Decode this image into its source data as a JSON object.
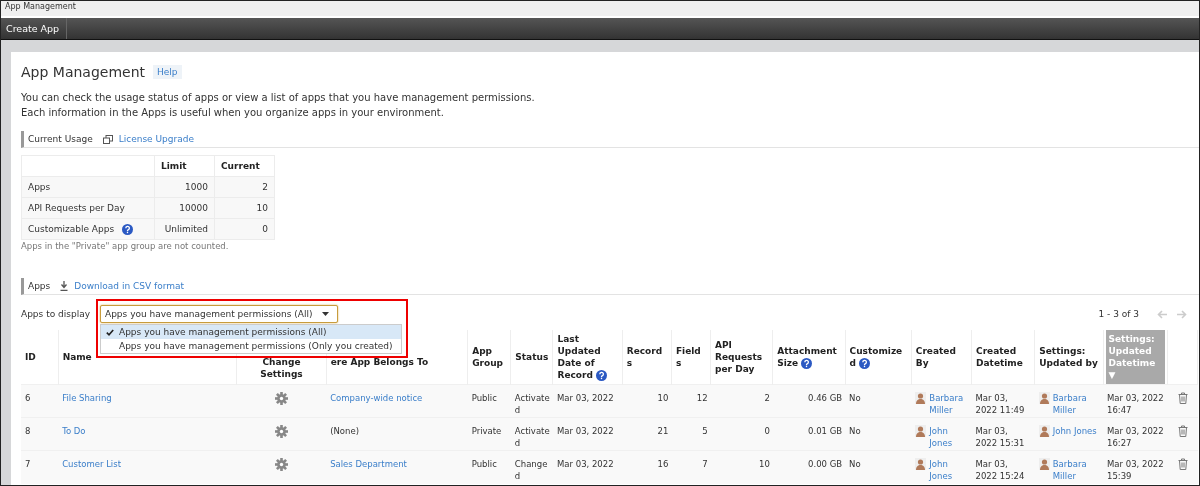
{
  "window": {
    "title": "App Management"
  },
  "toolbar": {
    "buttons": [
      "Create App"
    ]
  },
  "page": {
    "title": "App Management",
    "help_link": "Help",
    "description": [
      "You can check the usage status of apps or view a list of apps that you have management permissions.",
      "Each information in the Apps is useful when you organize apps in your environment."
    ]
  },
  "current_usage": {
    "heading": "Current Usage",
    "link": "License Upgrade",
    "columns": [
      "Limit",
      "Current"
    ],
    "rows": [
      {
        "label": "Apps",
        "limit": "1000",
        "current": "2"
      },
      {
        "label": "API Requests per Day",
        "limit": "10000",
        "current": "10"
      },
      {
        "label": "Customizable Apps",
        "help": true,
        "limit": "Unlimited",
        "current": "0"
      }
    ],
    "note": "Apps in the \"Private\" app group are not counted."
  },
  "apps": {
    "heading": "Apps",
    "download_link": "Download in CSV format",
    "filter": {
      "label": "Apps to display",
      "value": "Apps you have management permissions (All)",
      "expanded": true,
      "options": [
        {
          "label": "Apps you have management permissions (All)",
          "selected": true
        },
        {
          "label": "Apps you have management permissions (Only you created)",
          "selected": false
        }
      ]
    },
    "pagination": "1 - 3 of 3",
    "table": {
      "columns": [
        {
          "label": "ID",
          "kind": "text"
        },
        {
          "label": "Name",
          "kind": "link"
        },
        {
          "label": "Change Settings",
          "kind": "gear"
        },
        {
          "label": "ere App Belongs To",
          "kind": "space"
        },
        {
          "label": "App Group",
          "kind": "text"
        },
        {
          "label": "Status",
          "kind": "text"
        },
        {
          "label": "Last Updated Date of Record",
          "kind": "text",
          "help": true
        },
        {
          "label": "Records",
          "kind": "num"
        },
        {
          "label": "Fields",
          "kind": "num"
        },
        {
          "label": "API Requests per Day",
          "kind": "num"
        },
        {
          "label": "Attachment Size",
          "kind": "num",
          "help": true
        },
        {
          "label": "Customized",
          "kind": "text",
          "help": true
        },
        {
          "label": "Created By",
          "kind": "user"
        },
        {
          "label": "Created Datetime",
          "kind": "text"
        },
        {
          "label": "Settings: Updated by",
          "kind": "user"
        },
        {
          "label": "Settings: Updated Datetime",
          "kind": "text",
          "sorted": true,
          "sort_indicator": "▼"
        },
        {
          "kind": "trash"
        }
      ],
      "rows": [
        {
          "cells": [
            "6",
            "File Sharing",
            "",
            {
              "text": "Company-wide notice",
              "link": true
            },
            "Public",
            "Activated",
            "Mar 03, 2022",
            "10",
            "12",
            "2",
            "0.46 GB",
            "No",
            "Barbara Miller",
            "Mar 03, 2022 11:49",
            "Barbara Miller",
            "Mar 03, 2022 16:47",
            ""
          ]
        },
        {
          "cells": [
            "8",
            "To Do",
            "",
            {
              "text": "(None)",
              "link": false
            },
            "Private",
            "Activated",
            "Mar 03, 2022",
            "21",
            "5",
            "0",
            "0.01 GB",
            "No",
            "John Jones",
            "Mar 03, 2022 15:31",
            "John Jones",
            "Mar 03, 2022 16:27",
            ""
          ]
        },
        {
          "cells": [
            "7",
            "Customer List",
            "",
            {
              "text": "Sales Department",
              "link": true
            },
            "Public",
            "Changed",
            "Mar 03, 2022",
            "16",
            "7",
            "10",
            "0.00 GB",
            "No",
            "John Jones",
            "Mar 03, 2022 15:24",
            "Barbara Miller",
            "Mar 03, 2022 15:39",
            ""
          ]
        }
      ]
    }
  }
}
